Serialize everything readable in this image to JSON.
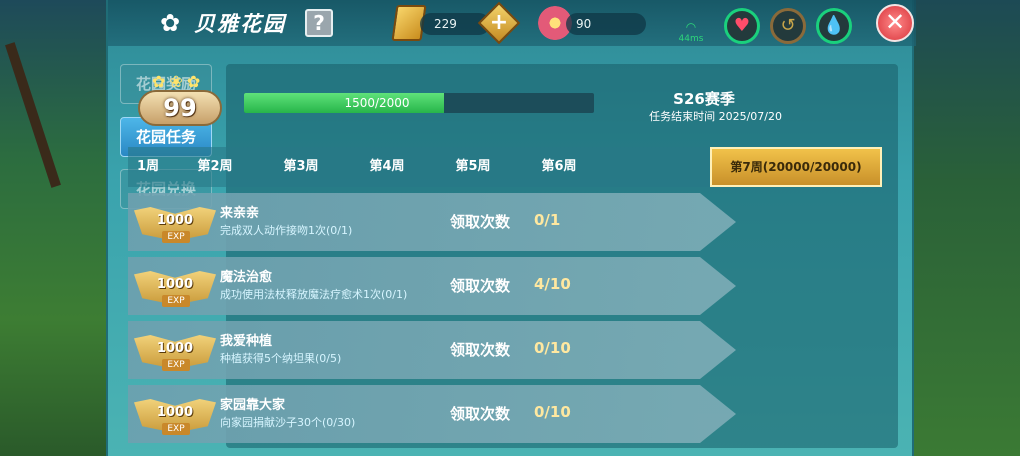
{
  "header": {
    "title": "贝雅花园",
    "help_label": "?",
    "gold_amount": "229",
    "flower_amount": "90",
    "signal_label": "44ms",
    "close_label": "✕"
  },
  "sidebar": {
    "items": [
      {
        "label": "花园奖励",
        "active": false
      },
      {
        "label": "花园任务",
        "active": true
      },
      {
        "label": "花园兑换",
        "active": false
      }
    ]
  },
  "garden": {
    "level": "99",
    "progress_text": "1500/2000",
    "progress_current": 1500,
    "progress_max": 2000,
    "season": "S26赛季",
    "season_end": "任务结束时间 2025/07/20"
  },
  "weeks": {
    "tabs": [
      "1周",
      "第2周",
      "第3周",
      "第4周",
      "第5周",
      "第6周",
      "第7周(20000/20000)"
    ],
    "active_index": 6
  },
  "tasks": [
    {
      "exp": "1000",
      "exp_label": "EXP",
      "name": "来亲亲",
      "desc": "完成双人动作接吻1次(0/1)",
      "claim_label": "领取次数",
      "claim_count": "0/1"
    },
    {
      "exp": "1000",
      "exp_label": "EXP",
      "name": "魔法治愈",
      "desc": "成功使用法杖释放魔法疗愈术1次(0/1)",
      "claim_label": "领取次数",
      "claim_count": "4/10"
    },
    {
      "exp": "1000",
      "exp_label": "EXP",
      "name": "我爱种植",
      "desc": "种植获得5个纳坦果(0/5)",
      "claim_label": "领取次数",
      "claim_count": "0/10"
    },
    {
      "exp": "1000",
      "exp_label": "EXP",
      "name": "家园靠大家",
      "desc": "向家园捐献沙子30个(0/30)",
      "claim_label": "领取次数",
      "claim_count": "0/10"
    }
  ]
}
